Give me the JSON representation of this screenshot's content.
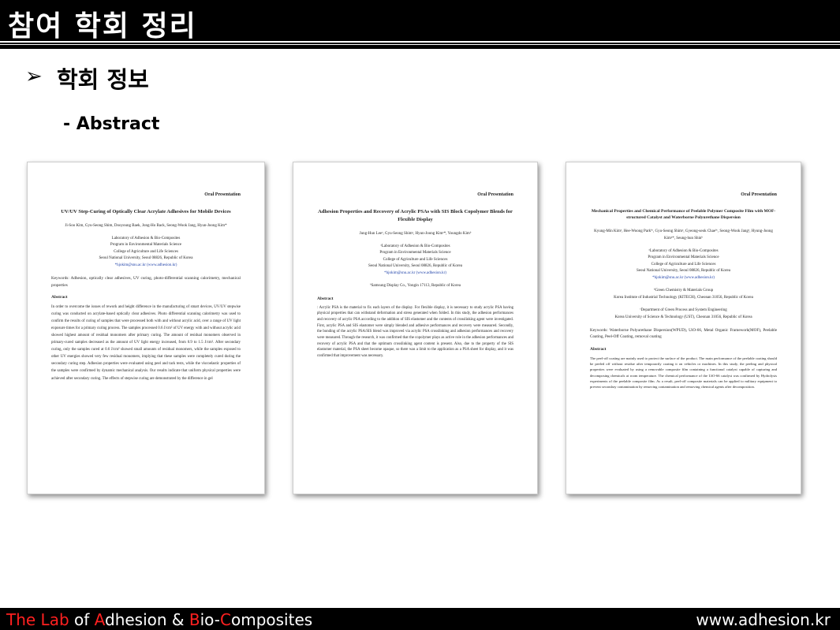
{
  "header": {
    "title": "참여 학회 정리"
  },
  "section": {
    "bullet": "➢",
    "heading": "학회 정보",
    "subheading": "- Abstract"
  },
  "papers": [
    {
      "label": "Oral Presentation",
      "title": "UV/UV Step-Curing of Optically Clear Acrylate Adhesives for Mobile Devices",
      "authors": "Ji-Soo Kim, Gyu-Seong Shim, Dooyoung Baek, Jong-Ho Back, Seong-Wook Jang, Hyun-Joong Kim*",
      "affiliation": "Laboratory of Adhesion & Bio-Composites\nProgram in Environmental Materials Science\nCollege of Agriculture and Life Sciences\nSeoul National University, Seoul 08826, Republic of Korea",
      "email": "*hjokim@snu.ac.kr (www.adhesion.kr)",
      "keywords": "Keywords: Adhesion, optically clear adhesives, UV curing, photo-differential scanning calorimetry, mechanical properties",
      "abstract_heading": "Abstract",
      "abstract": "In order to overcome the issues of rework and height difference in the manufacturing of smart devices, UV/UV stepwise curing was conducted on acrylate-based optically clear adhesives. Photo differential scanning calorimetry was used to confirm the results of curing of samples that were processed both with and without acrylic acid, over a range of UV light exposure times for a primary curing process. The samples processed 0.6 J/cm² of UV energy with and without acrylic acid showed highest amount of residual monomers after primary curing. The amount of residual monomers observed in primary-cured samples decreased as the amount of UV light energy increased, from 0.9 to 1.5 J/cm². After secondary curing, only the samples cured at 0.6 J/cm² showed small amounts of residual monomers, while the samples exposed to other UV energies showed very few residual monomers, implying that these samples were completely cured during the secondary curing step. Adhesion properties were evaluated using peel and tack tests, while the viscoelastic properties of the samples were confirmed by dynamic mechanical analysis. Our results indicate that uniform physical properties were achieved after secondary curing. The effects of stepwise curing are demonstrated by the difference in gel"
    },
    {
      "label": "Oral Presentation",
      "title": "Adhesion Properties and Recovery of Acrylic PSAs with SIS Block Copolymer Blends for Flexible Display",
      "authors": "Jung-Hun Leeᵃ, Gyu-Seong Shimᵃ, Hyun-Joong Kimᵃ*, Youngdo Kimᵇ",
      "affiliation": "ᵃLaboratory of Adhesion & Bio-Composites\nProgram in Environmental Materials Science\nCollege of Agriculture and Life Sciences\nSeoul National University, Seoul 08826, Republic of Korea",
      "email": "*hjokim@snu.ac.kr (www.adhesion.kr)",
      "keywords": "ᵇSamsung Display Co., Yongin 17113, Republic of Korea",
      "abstract_heading": "Abstract",
      "abstract": ": Acrylic PSA is the material to fix each layers of the display. For flexible display, it is necessary to study acrylic PSA having physical properties that can withstand deformation and stress generated when folded. In this study, the adhesion performances and recovery of acrylic PSA according to the addition of SIS elastomer and the contents of crosslinking agent were investigated. First, acrylic PSA and SIS elastomer were simply blended and adhesive performances and recovery were measured. Secondly, the bonding of the acrylic PSA/SIS blend was improved via acrylic PSA crosslinking and adhesion performances and recovery were measured. Through the research, it was confirmed that the copolymer plays as active role in the adhesion performances and recovery of acrylic PSA and that the optimum crosslinking agent content is present. Also, due to the property of the SIS elastomer material, the PSA sheet become opaque, so there was a limit to the application as a PSA sheet for display, and it was confirmed that improvement was necessary."
    },
    {
      "label": "Oral Presentation",
      "title": "Mechanical Properties and Chemical Performance of Peelable Polymer Composite Film with MOF-structured Catalyst and Waterborne Polyurethane Dispersion",
      "authors": "Kyung-Min Kimᵃ, Hee-Woong Parkᵇᶜ, Gyu-Seong Shimᵃ, Gyeong-seok Chaeᵇᶜ, Seong-Wook Jangᵃ, Hyung-Joong Kimᵃ*, Seung-hun Shinᵇ",
      "affiliation": "ᵃLaboratory of Adhesion & Bio-Composites\nProgram in Environmental Materials Science\nCollege of Agriculture and Life Sciences\nSeoul National University, Seoul 08826, Republic of Korea",
      "email": "*hjokim@snu.ac.kr (www.adhesion.kr)",
      "affiliation2": "ᵇGreen Chemistry & Materials Group\nKorea Institute of Industrial Technology (KITECH), Cheonan 31056, Republic of Korea",
      "affiliation3": "ᶜDepartment of Green Process and System Engineering\nKorea University of Science & Technology (UST), Cheonan 31056, Republic of Korea",
      "keywords": "Keywords: Waterborne Polyurethane Dispersion(WPUD), UiO-66, Metal Organic Framework(MOF), Peelable Coating, Peel-Off Coating, removal coating",
      "abstract_heading": "Abstract",
      "abstract": "The peel-off coating are mainly used to protect the surface of the product. The main performance of the peelable coating should be peeled off without residue after temporarily coating it on vehicles or machines. In this study, the peeling and physical properties were evaluated by using a removable composite film containing a functional catalyst capable of capturing and decomposing chemicals at room temperature. The chemical performance of the UiO-66 catalyst was confirmed by Hydrolysis experiments of the peelable composite film. As a result, peel-off composite materials can be applied to military equipment to prevent secondary contamination by removing contamination and removing chemical agents after decomposition."
    }
  ],
  "footer": {
    "lab_parts": [
      {
        "text": "The Lab",
        "color": "red"
      },
      {
        "text": " of ",
        "color": "white"
      },
      {
        "text": "A",
        "color": "red"
      },
      {
        "text": "dhesion & ",
        "color": "white"
      },
      {
        "text": "B",
        "color": "red"
      },
      {
        "text": "io-",
        "color": "white"
      },
      {
        "text": "C",
        "color": "red"
      },
      {
        "text": "omposites",
        "color": "white"
      }
    ],
    "url": "www.adhesion.kr"
  }
}
